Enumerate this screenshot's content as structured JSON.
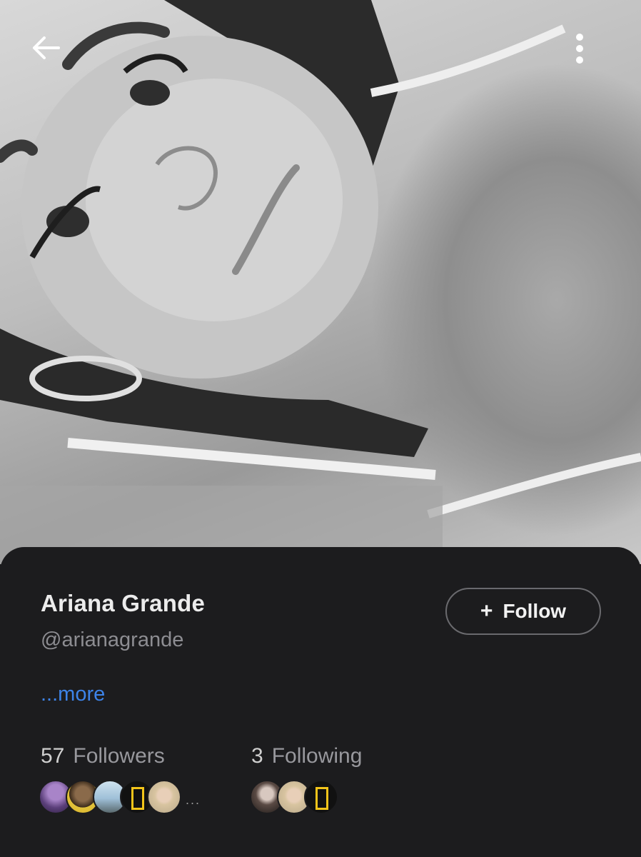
{
  "profile": {
    "name": "Ariana Grande",
    "handle": "@arianagrande",
    "more_label": "...more",
    "follow_label": "Follow",
    "follow_icon": "plus-icon"
  },
  "stats": {
    "followers_count": "57",
    "followers_label": "Followers",
    "following_count": "3",
    "following_label": "Following",
    "followers_ellipsis": "..."
  },
  "colors": {
    "background": "#1c1c1e",
    "link": "#3d83e8",
    "name_text": "#ececec",
    "secondary_text": "#8d8d92",
    "button_border": "#6a6a6e"
  },
  "icons": {
    "back": "back-arrow-icon",
    "menu": "more-vertical-icon"
  }
}
